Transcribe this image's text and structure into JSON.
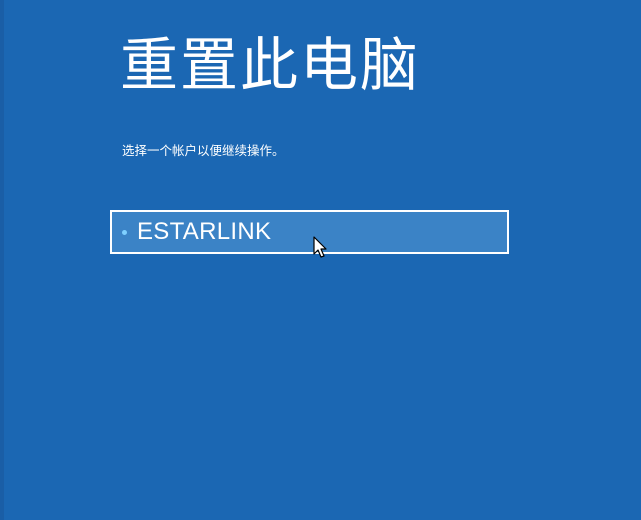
{
  "page": {
    "title": "重置此电脑",
    "subtitle": "选择一个帐户以便继续操作。"
  },
  "accounts": [
    {
      "name": "ESTARLINK",
      "selected": true
    }
  ],
  "colors": {
    "background": "#1b67b3",
    "selected_item": "#3b83c6",
    "bullet": "#7fd0ff"
  },
  "icons": {
    "bullet": "dot-bullet-icon",
    "cursor": "mouse-pointer-icon"
  }
}
